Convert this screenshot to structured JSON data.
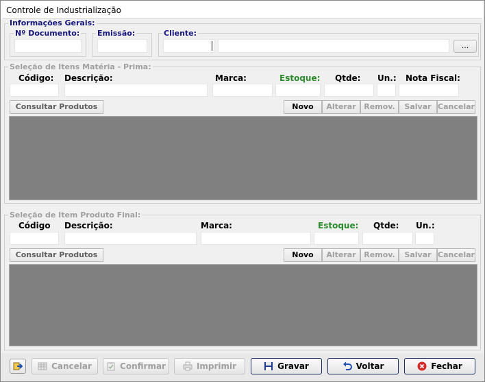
{
  "window": {
    "title": "Controle de Industrialização"
  },
  "info": {
    "legend": "Informações Gerais:",
    "doc_label": "Nº Documento:",
    "doc_value": "",
    "emissao_label": "Emissão:",
    "emissao_value": "",
    "cliente_label": "Cliente:",
    "cliente_code": "",
    "cliente_name": "",
    "browse_label": "..."
  },
  "materia": {
    "legend": "Seleção de Itens Matéria - Prima:",
    "cols": {
      "codigo": "Código:",
      "descricao": "Descrição:",
      "marca": "Marca:",
      "estoque": "Estoque:",
      "qtde": "Qtde:",
      "un": "Un.:",
      "nota": "Nota Fiscal:"
    },
    "consultar": "Consultar Produtos",
    "actions": {
      "novo": "Novo",
      "alterar": "Alterar",
      "remov": "Remov.",
      "salvar": "Salvar",
      "cancelar": "Cancelar"
    }
  },
  "produto": {
    "legend": "Seleção de Item Produto Final:",
    "cols": {
      "codigo": "Código",
      "descricao": "Descrição:",
      "marca": "Marca:",
      "estoque": "Estoque:",
      "qtde": "Qtde:",
      "un": "Un.:"
    },
    "consultar": "Consultar Produtos",
    "actions": {
      "novo": "Novo",
      "alterar": "Alterar",
      "remov": "Remov.",
      "salvar": "Salvar",
      "cancelar": "Cancelar"
    }
  },
  "footer": {
    "cancelar": "Cancelar",
    "confirmar": "Confirmar",
    "imprimir": "Imprimir",
    "gravar": "Gravar",
    "voltar": "Voltar",
    "fechar": "Fechar"
  },
  "colors": {
    "label_navy": "#15157a",
    "estoque_green": "#2b8a2b",
    "grid_gray": "#808080",
    "disabled_text": "#a0a0a0"
  }
}
